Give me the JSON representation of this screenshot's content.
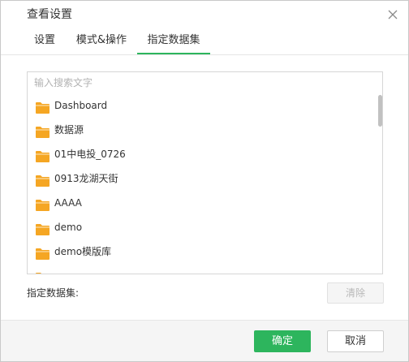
{
  "dialog": {
    "title": "查看设置",
    "close_icon": "close-icon"
  },
  "tabs": [
    {
      "label": "设置",
      "active": false
    },
    {
      "label": "模式&操作",
      "active": false
    },
    {
      "label": "指定数据集",
      "active": true
    }
  ],
  "search": {
    "placeholder": "输入搜索文字",
    "value": ""
  },
  "folder_icon": "folder-icon",
  "folder_color": "#f5a623",
  "list": {
    "items": [
      {
        "label": "Dashboard"
      },
      {
        "label": "数据源"
      },
      {
        "label": "01中电投_0726"
      },
      {
        "label": "0913龙湖天街"
      },
      {
        "label": "AAAA"
      },
      {
        "label": "demo"
      },
      {
        "label": "demo模版库"
      },
      {
        "label": ""
      }
    ]
  },
  "selection": {
    "label": "指定数据集:",
    "clear_label": "清除"
  },
  "footer": {
    "ok_label": "确定",
    "cancel_label": "取消"
  },
  "colors": {
    "accent": "#2db55d",
    "folder": "#f5a623"
  }
}
